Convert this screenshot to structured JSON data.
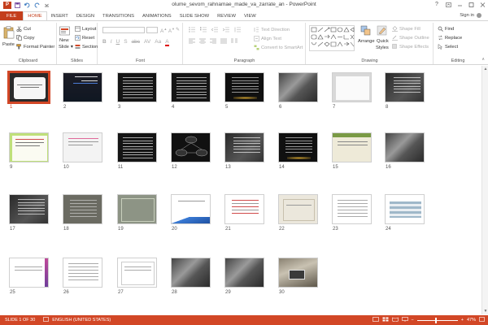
{
  "title_bar": {
    "app_icon_label": "P",
    "window_title": "olume_sevom_rahnamae_made_va_zarrate_an - PowerPoint",
    "icons": [
      "save-icon",
      "undo-icon",
      "redo-icon",
      "customize-quick-access-icon"
    ],
    "controls": [
      "help-icon",
      "ribbon-display-icon",
      "minimize-icon",
      "maximize-icon",
      "close-icon"
    ]
  },
  "tabs": [
    {
      "label": "FILE"
    },
    {
      "label": "HOME"
    },
    {
      "label": "INSERT"
    },
    {
      "label": "DESIGN"
    },
    {
      "label": "TRANSITIONS"
    },
    {
      "label": "ANIMATIONS"
    },
    {
      "label": "SLIDE SHOW"
    },
    {
      "label": "REVIEW"
    },
    {
      "label": "VIEW"
    }
  ],
  "signin": "Sign in",
  "ribbon": {
    "clipboard": {
      "label": "Clipboard",
      "paste": "Paste",
      "cut": "Cut",
      "copy": "Copy",
      "format_painter": "Format Painter"
    },
    "slides": {
      "label": "Slides",
      "new_slide_1": "New",
      "new_slide_2": "Slide",
      "layout": "Layout",
      "reset": "Reset",
      "section": "Section"
    },
    "font": {
      "label": "Font"
    },
    "paragraph": {
      "label": "Paragraph",
      "text_direction": "Text Direction",
      "align_text": "Align Text",
      "convert_smartart": "Convert to SmartArt"
    },
    "drawing": {
      "label": "Drawing",
      "arrange": "Arrange",
      "quick_styles_1": "Quick",
      "quick_styles_2": "Styles",
      "shape_fill": "Shape Fill",
      "shape_outline": "Shape Outline",
      "shape_effects": "Shape Effects"
    },
    "editing": {
      "label": "Editing",
      "find": "Find",
      "replace": "Replace",
      "select": "Select"
    }
  },
  "slides": [
    {
      "num": "1",
      "theme": "frame-dark",
      "selected": true
    },
    {
      "num": "2",
      "theme": "dark-blue"
    },
    {
      "num": "3",
      "theme": "dark"
    },
    {
      "num": "4",
      "theme": "dark"
    },
    {
      "num": "5",
      "theme": "dark-glow"
    },
    {
      "num": "6",
      "theme": "grey-diag"
    },
    {
      "num": "7",
      "theme": "light-frame"
    },
    {
      "num": "8",
      "theme": "dark-grey"
    },
    {
      "num": "9",
      "theme": "green-frame"
    },
    {
      "num": "10",
      "theme": "light"
    },
    {
      "num": "11",
      "theme": "dark"
    },
    {
      "num": "12",
      "theme": "diagram-dark"
    },
    {
      "num": "13",
      "theme": "dark-grey"
    },
    {
      "num": "14",
      "theme": "dark-glow"
    },
    {
      "num": "15",
      "theme": "green-tan"
    },
    {
      "num": "16",
      "theme": "grey-diag"
    },
    {
      "num": "17",
      "theme": "dark-grey"
    },
    {
      "num": "18",
      "theme": "grey"
    },
    {
      "num": "19",
      "theme": "olive"
    },
    {
      "num": "20",
      "theme": "white-blue"
    },
    {
      "num": "21",
      "theme": "white-red"
    },
    {
      "num": "22",
      "theme": "beige"
    },
    {
      "num": "23",
      "theme": "white-text"
    },
    {
      "num": "24",
      "theme": "white-table"
    },
    {
      "num": "25",
      "theme": "white-pink"
    },
    {
      "num": "26",
      "theme": "white-text"
    },
    {
      "num": "27",
      "theme": "white-box"
    },
    {
      "num": "28",
      "theme": "grey-diag"
    },
    {
      "num": "29",
      "theme": "grey-diag"
    },
    {
      "num": "30",
      "theme": "photo"
    }
  ],
  "status": {
    "slide_counter": "SLIDE 1 OF 30",
    "language": "ENGLISH (UNITED STATES)",
    "zoom": "47%"
  },
  "colors": {
    "accent": "#d24726",
    "file_tab": "#c43e1c"
  }
}
